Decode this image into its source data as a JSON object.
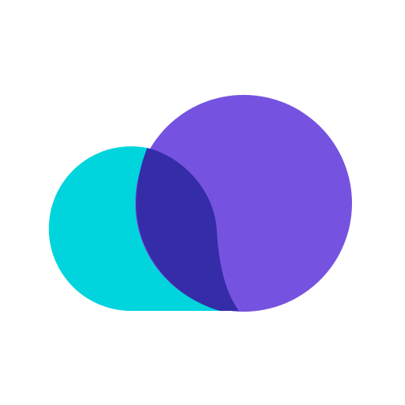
{
  "logo": {
    "icon": "cloud-logo-icon",
    "colors": {
      "background": "#ffffff",
      "left_lobe": "#00d4dc",
      "right_circle": "#7553e0",
      "overlap": "#352ca8"
    }
  }
}
